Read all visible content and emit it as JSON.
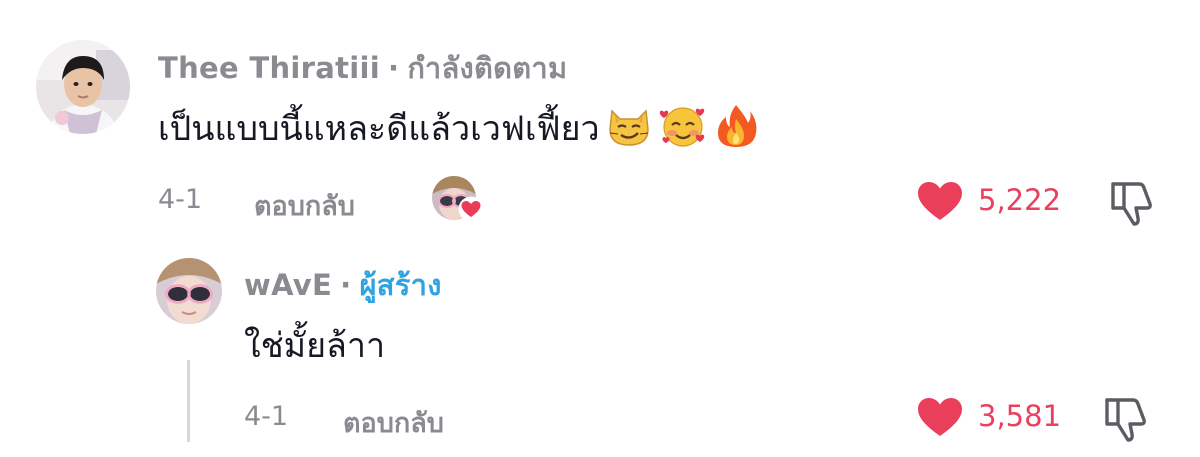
{
  "comment": {
    "username": "Thee Thiratiii",
    "separator": "·",
    "relation_badge": "กำลังติดตาม",
    "text": "เป็นแบบนี้แหละดีแล้วเวฟเฟี้ยว",
    "emojis": [
      "smirk-cat-icon",
      "smiling-face-with-hearts-icon",
      "fire-icon"
    ],
    "date": "4-1",
    "reply_label": "ตอบกลับ",
    "like_count": "5,222",
    "creator_liked": true
  },
  "reply": {
    "username": "wAvE",
    "separator": "·",
    "relation_badge": "ผู้สร้าง",
    "text": "ใช่มั้ยล้าา",
    "date": "4-1",
    "reply_label": "ตอบกลับ",
    "like_count": "3,581"
  },
  "colors": {
    "like": "#e8415f",
    "creator_badge": "#2fa3e0",
    "muted": "#8a8b91"
  }
}
